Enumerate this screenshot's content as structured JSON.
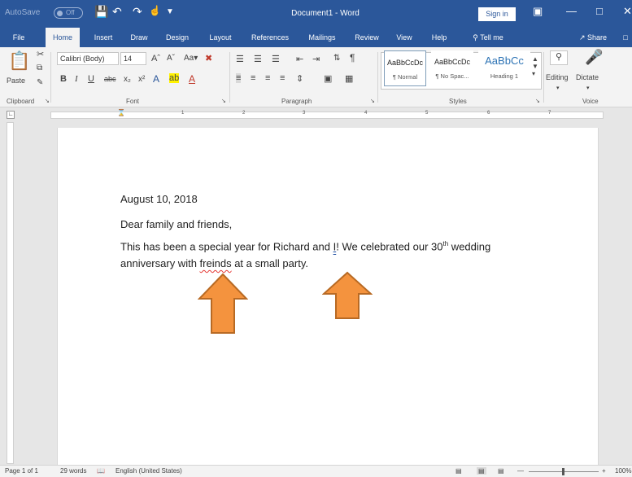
{
  "titlebar": {
    "autosave": "AutoSave",
    "autosave_state": "Off",
    "title": "Document1 - Word",
    "sign_in": "Sign in"
  },
  "tabs": [
    "File",
    "Home",
    "Insert",
    "Draw",
    "Design",
    "Layout",
    "References",
    "Mailings",
    "Review",
    "View",
    "Help"
  ],
  "tell_me": "Tell me",
  "share": "Share",
  "ribbon": {
    "paste": "Paste",
    "font_name": "Calibri (Body)",
    "font_size": "14",
    "styles": [
      {
        "sample": "AaBbCcDc",
        "name": "¶ Normal"
      },
      {
        "sample": "AaBbCcDc",
        "name": "¶ No Spac..."
      },
      {
        "sample": "AaBbCc",
        "name": "Heading 1"
      }
    ],
    "editing": "Editing",
    "dictate": "Dictate",
    "groups": {
      "clipboard": "Clipboard",
      "font": "Font",
      "paragraph": "Paragraph",
      "styles": "Styles",
      "voice": "Voice"
    }
  },
  "ruler_numbers": [
    "1",
    "2",
    "3",
    "4",
    "5",
    "6",
    "7"
  ],
  "document": {
    "date": "August 10, 2018",
    "greeting": "Dear family and friends,",
    "line1_a": "This has been a special year for Richard and ",
    "line1_err": "I",
    "line1_b": "! We celebrated our 30",
    "line1_sup": "th",
    "line1_c": " wedding",
    "line2_a": "anniversary with ",
    "line2_err": "freinds",
    "line2_b": " at a small party."
  },
  "status": {
    "page": "Page 1 of 1",
    "words": "29 words",
    "language": "English (United States)",
    "zoom": "100%"
  },
  "colors": {
    "brand": "#2b579a",
    "arrow_fill": "#f4933e",
    "arrow_stroke": "#b86a24",
    "spell_error": "#e53935"
  }
}
